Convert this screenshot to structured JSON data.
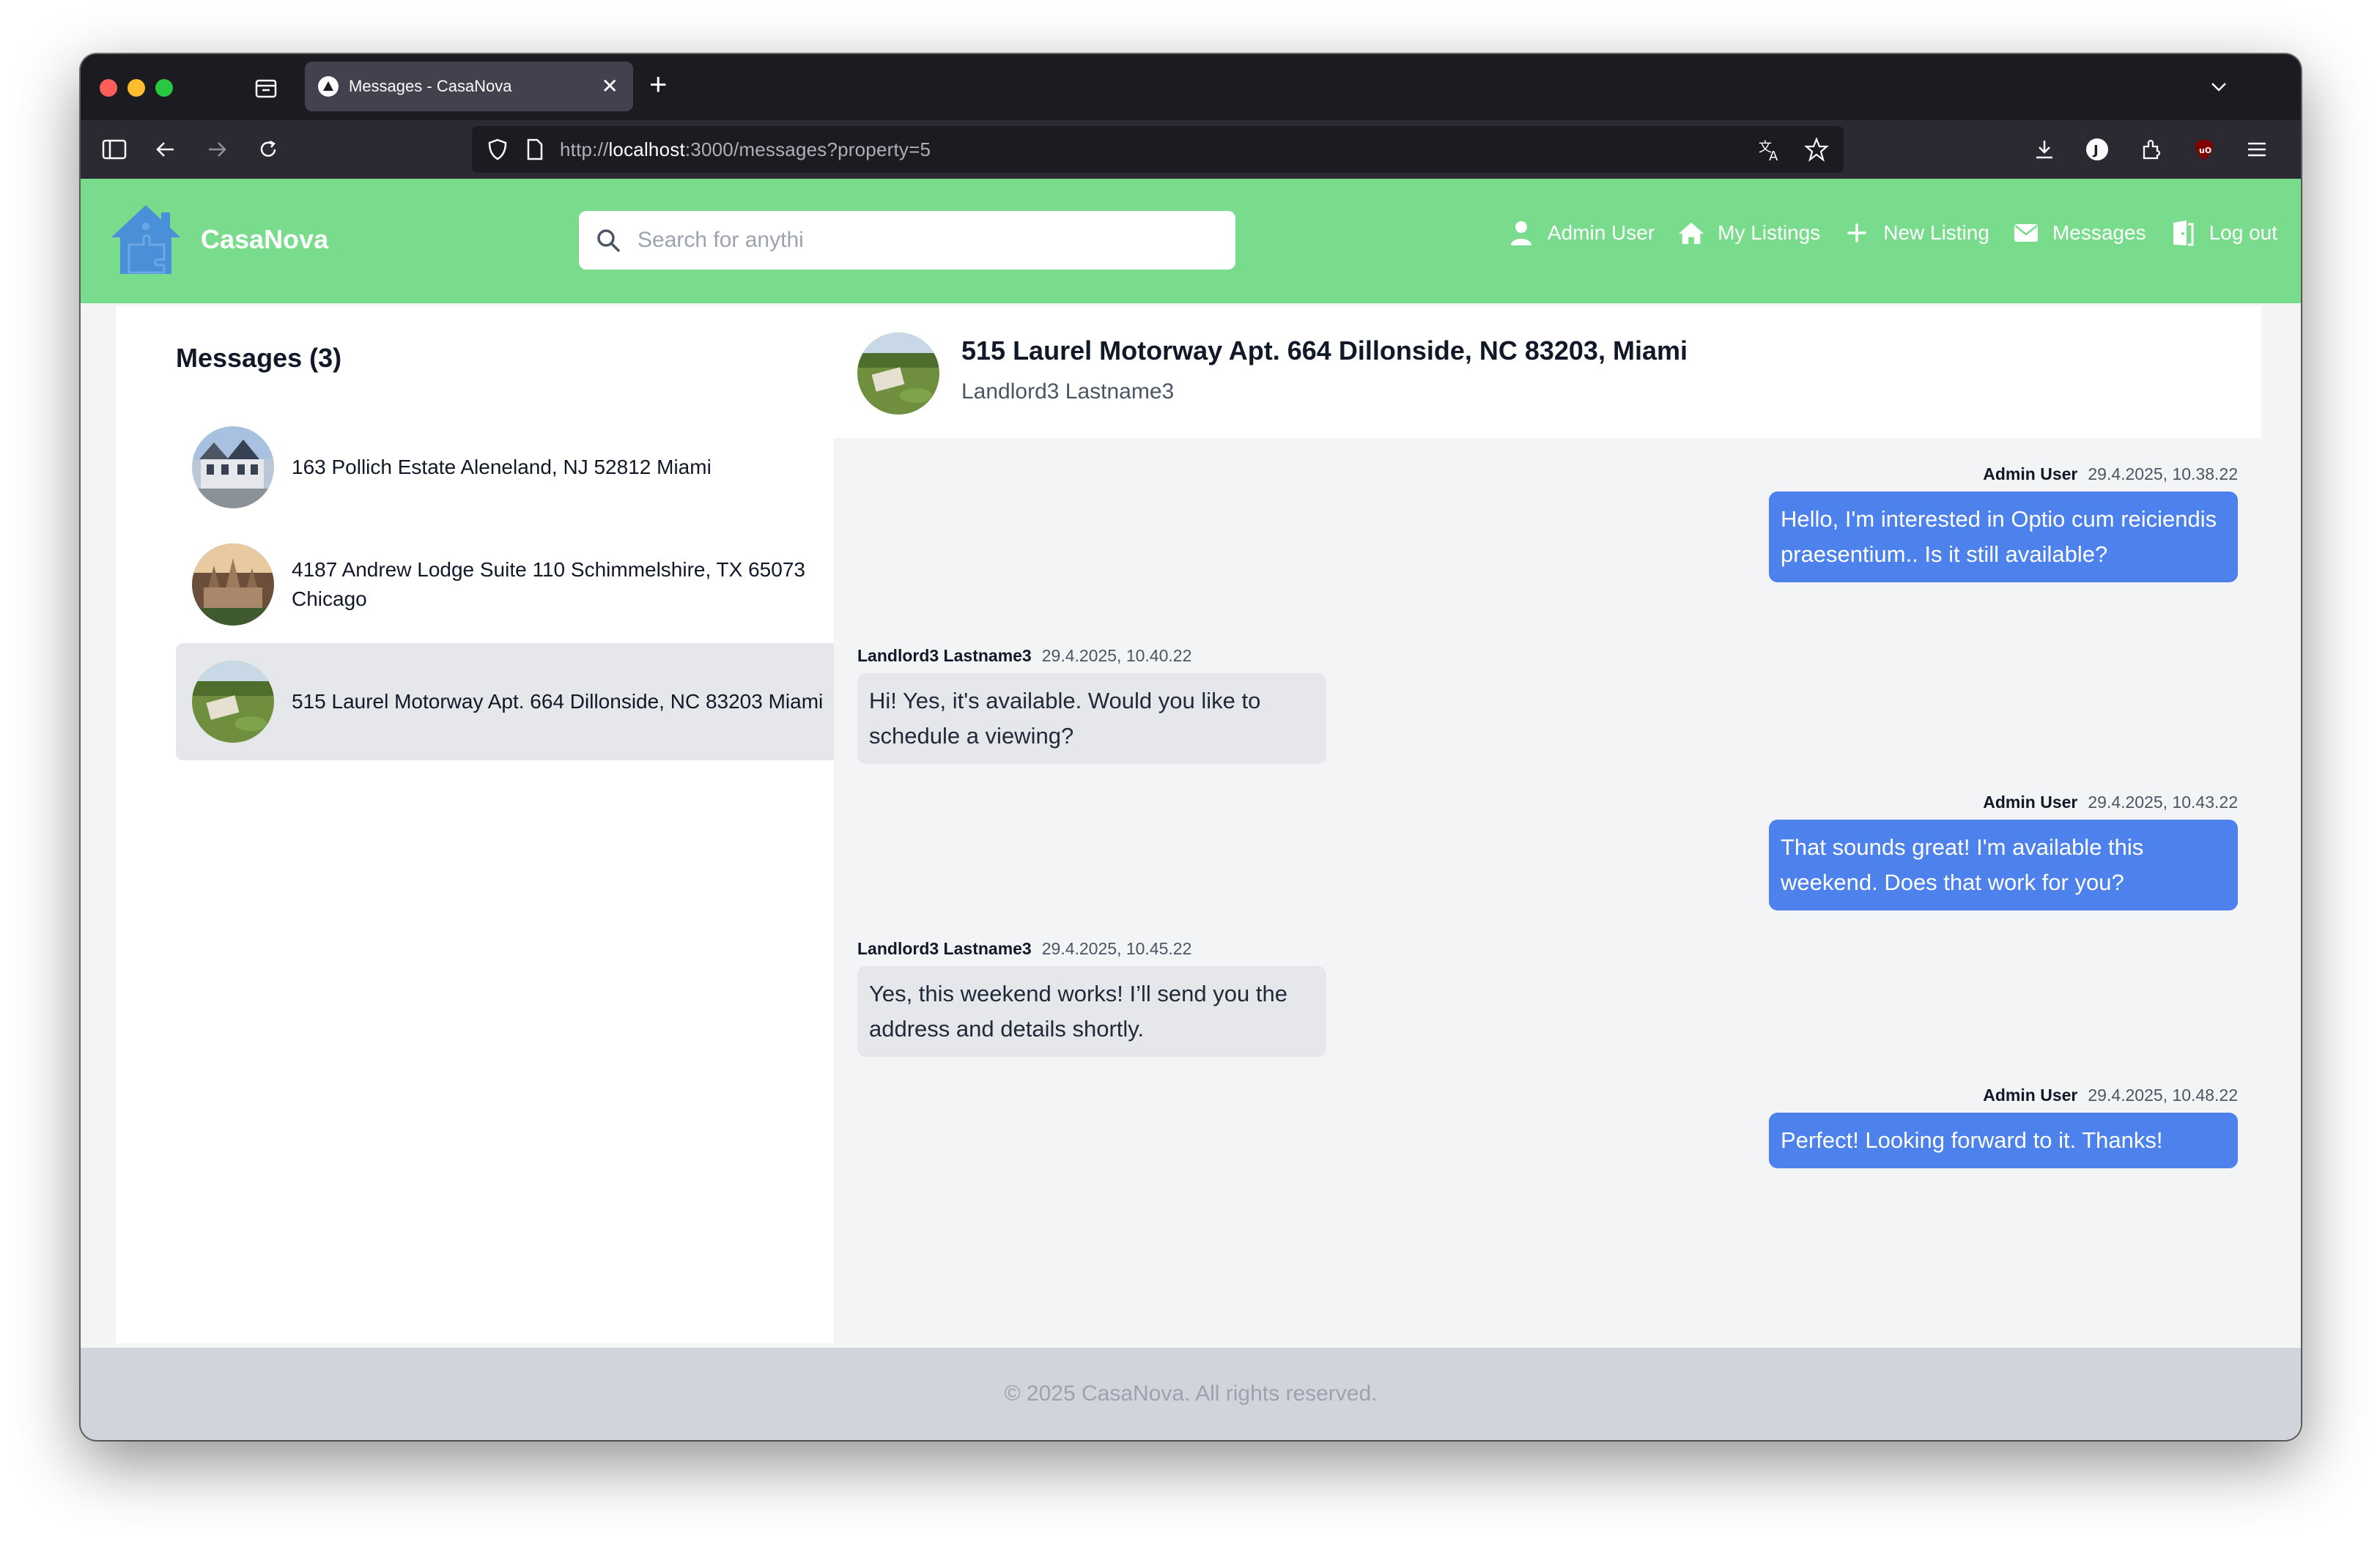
{
  "browser": {
    "tab_title": "Messages - CasaNova",
    "url_prefix": "http://",
    "url_host": "localhost",
    "url_path": ":3000/messages?property=5"
  },
  "header": {
    "brand": "CasaNova",
    "search_placeholder": "Search for anythi",
    "nav": {
      "user": "Admin User",
      "my_listings": "My Listings",
      "new_listing": "New Listing",
      "messages": "Messages",
      "logout": "Log out"
    }
  },
  "sidebar": {
    "title": "Messages (3)",
    "conversations": [
      {
        "address": "163 Pollich Estate Aleneland, NJ 52812 Miami",
        "active": false
      },
      {
        "address": "4187 Andrew Lodge Suite 110 Schimmelshire, TX 65073 Chicago",
        "active": false
      },
      {
        "address": "515 Laurel Motorway Apt. 664 Dillonside, NC 83203 Miami",
        "active": true
      }
    ]
  },
  "chat": {
    "title": "515 Laurel Motorway Apt. 664 Dillonside, NC 83203, Miami",
    "subtitle": "Landlord3 Lastname3",
    "messages": [
      {
        "sender": "Admin User",
        "time": "29.4.2025, 10.38.22",
        "text": "Hello, I'm interested in Optio cum reiciendis praesentium.. Is it still available?",
        "mine": true
      },
      {
        "sender": "Landlord3 Lastname3",
        "time": "29.4.2025, 10.40.22",
        "text": "Hi! Yes, it's available. Would you like to schedule a viewing?",
        "mine": false
      },
      {
        "sender": "Admin User",
        "time": "29.4.2025, 10.43.22",
        "text": "That sounds great! I'm available this weekend. Does that work for you?",
        "mine": true
      },
      {
        "sender": "Landlord3 Lastname3",
        "time": "29.4.2025, 10.45.22",
        "text": "Yes, this weekend works! I’ll send you the address and details shortly.",
        "mine": false
      },
      {
        "sender": "Admin User",
        "time": "29.4.2025, 10.48.22",
        "text": "Perfect! Looking forward to it. Thanks!",
        "mine": true
      }
    ]
  },
  "footer": {
    "text": "© 2025 CasaNova. All rights reserved."
  },
  "colors": {
    "header_green": "#78dc8c",
    "bubble_blue": "#4d82ec",
    "bubble_gray": "#e5e7eb",
    "active_item": "#e5e7eb"
  }
}
